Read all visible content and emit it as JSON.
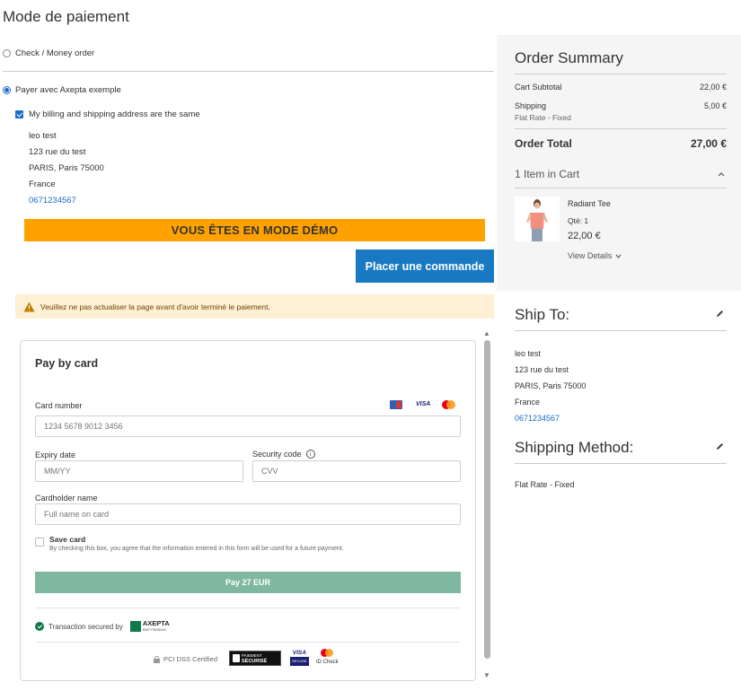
{
  "page_title": "Mode de paiement",
  "payment_methods": [
    {
      "label": "Check / Money order",
      "selected": false
    },
    {
      "label": "Payer avec Axepta exemple",
      "selected": true
    }
  ],
  "billing_same_label": "My billing and shipping address are the same",
  "billing_address": {
    "name": "leo test",
    "street": "123 rue du test",
    "city": "PARIS, Paris 75000",
    "country": "France",
    "phone": "0671234567"
  },
  "demo_banner": "VOUS ÊTES EN MODE DÉMO",
  "place_order_label": "Placer une commande",
  "warning_text": "Veuillez ne pas actualiser la page avant d'avoir terminé le paiement.",
  "card_form": {
    "title": "Pay by card",
    "card_number_label": "Card number",
    "card_number_placeholder": "1234 5678 9012 3456",
    "expiry_label": "Expiry date",
    "expiry_placeholder": "MM/YY",
    "cvv_label": "Security code",
    "cvv_placeholder": "CVV",
    "holder_label": "Cardholder name",
    "holder_placeholder": "Full name on card",
    "save_card_label": "Save card",
    "save_card_note": "By checking this box, you agree that the information entered in this form will be used for a future payment.",
    "pay_button": "Pay 27 EUR",
    "secured_text": "Transaction secured by",
    "axepta_logo": "AXEPTA",
    "axepta_sub": "BNP PARIBAS",
    "pci_text": "PCI DSS Certified",
    "paiement_badge_top": "PAIEMENT",
    "paiement_badge_bottom": "SÉCURISÉ",
    "visa_text": "VISA",
    "visa_sub": "SECURE",
    "id_check_text": "ID Check",
    "card_brand_visa": "VISA"
  },
  "order_summary": {
    "title": "Order Summary",
    "subtotal_label": "Cart Subtotal",
    "subtotal_value": "22,00 €",
    "shipping_label": "Shipping",
    "shipping_sub": "Flat Rate - Fixed",
    "shipping_value": "5,00 €",
    "total_label": "Order Total",
    "total_value": "27,00 €",
    "items_in_cart": "1 Item in Cart",
    "item": {
      "name": "Radiant Tee",
      "qty": "Qté: 1",
      "price": "22,00 €",
      "details": "View Details"
    }
  },
  "ship_to": {
    "title": "Ship To:",
    "name": "leo test",
    "street": "123 rue du test",
    "city": "PARIS, Paris 75000",
    "country": "France",
    "phone": "0671234567"
  },
  "shipping_method": {
    "title": "Shipping Method:",
    "value": "Flat Rate - Fixed"
  },
  "colors": {
    "accent": "#1979c3",
    "demo_banner": "#ffa200",
    "pay_button": "#7fb8a0",
    "warning_bg": "#fdf0d5"
  }
}
